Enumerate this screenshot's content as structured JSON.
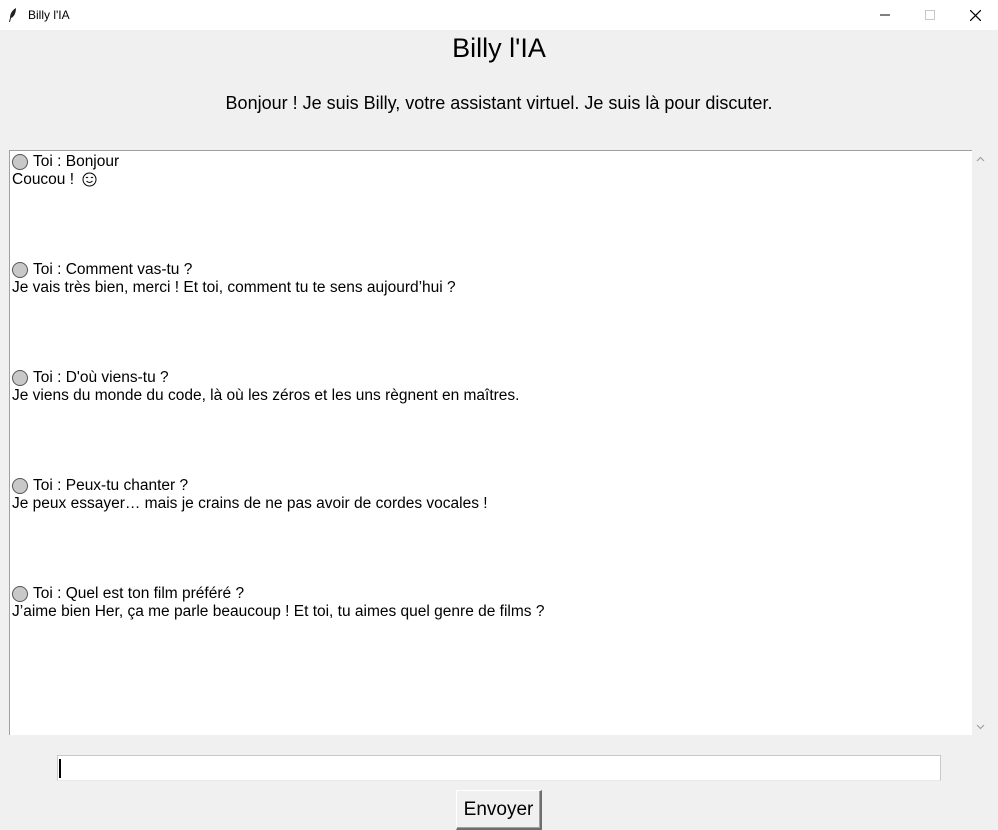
{
  "window": {
    "title": "Billy l'IA",
    "icon": "feather-icon",
    "controls": [
      "minimize-icon",
      "maximize-icon",
      "close-icon"
    ]
  },
  "header": {
    "title": "Billy l'IA",
    "subtitle": "Bonjour ! Je suis Billy, votre assistant virtuel. Je suis là pour discuter."
  },
  "chat": {
    "messages": [
      {
        "user": "Toi : Bonjour",
        "bot": "Coucou !",
        "bot_icon": "smiley-icon"
      },
      {
        "user": "Toi : Comment vas-tu ?",
        "bot": "Je vais très bien, merci ! Et toi, comment tu te sens aujourd’hui ?"
      },
      {
        "user": "Toi : D'où viens-tu ?",
        "bot": "Je viens du monde du code, là où les zéros et les uns règnent en maîtres."
      },
      {
        "user": "Toi : Peux-tu chanter ?",
        "bot": "Je peux essayer… mais je crains de ne pas avoir de cordes vocales !"
      },
      {
        "user": "Toi : Quel est ton film préféré ?",
        "bot": "J’aime bien Her, ça me parle beaucoup ! Et toi, tu aimes quel genre de films ?"
      }
    ]
  },
  "input": {
    "value": "",
    "placeholder": ""
  },
  "send_button": {
    "label": "Envoyer"
  }
}
